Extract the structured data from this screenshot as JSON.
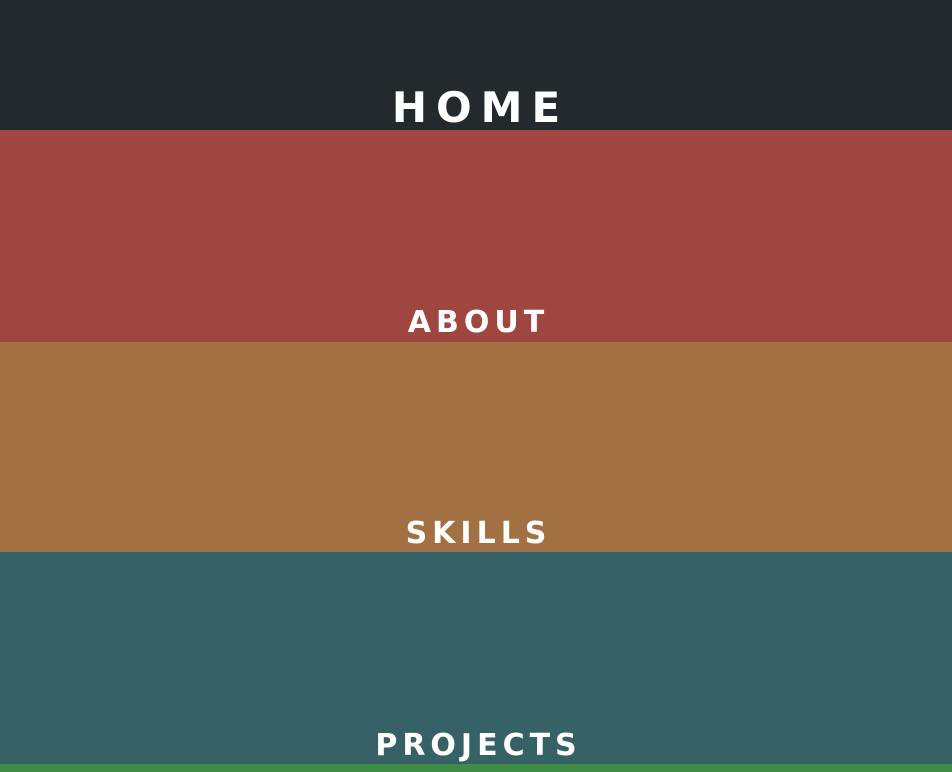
{
  "nav": {
    "items": [
      {
        "label": "HOME",
        "color": "#222a2e"
      },
      {
        "label": "ABOUT",
        "color": "#9f4641"
      },
      {
        "label": "SKILLS",
        "color": "#a37042"
      },
      {
        "label": "PROJECTS",
        "color": "#366267"
      }
    ],
    "next_band_color": "#3f8c45",
    "text_color": "#ffffff"
  }
}
